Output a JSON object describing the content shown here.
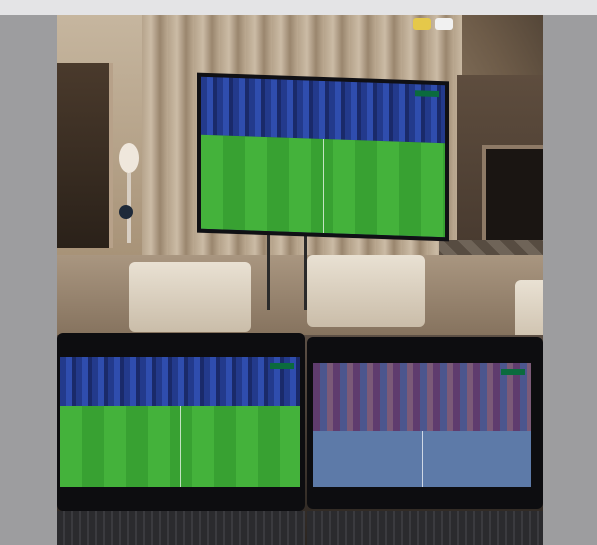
{
  "scene": {
    "description_free": true,
    "colors": {
      "page_background": "#d9d9db",
      "side_margin": "#9d9d9f",
      "pitch_green": "#44b23b",
      "crowd_blue": "#233a8c",
      "tablet_tint": "#3e4f86",
      "ceiling_light_yellow": "#e5c84a",
      "ceiling_light_white": "#f1f1f1"
    }
  }
}
